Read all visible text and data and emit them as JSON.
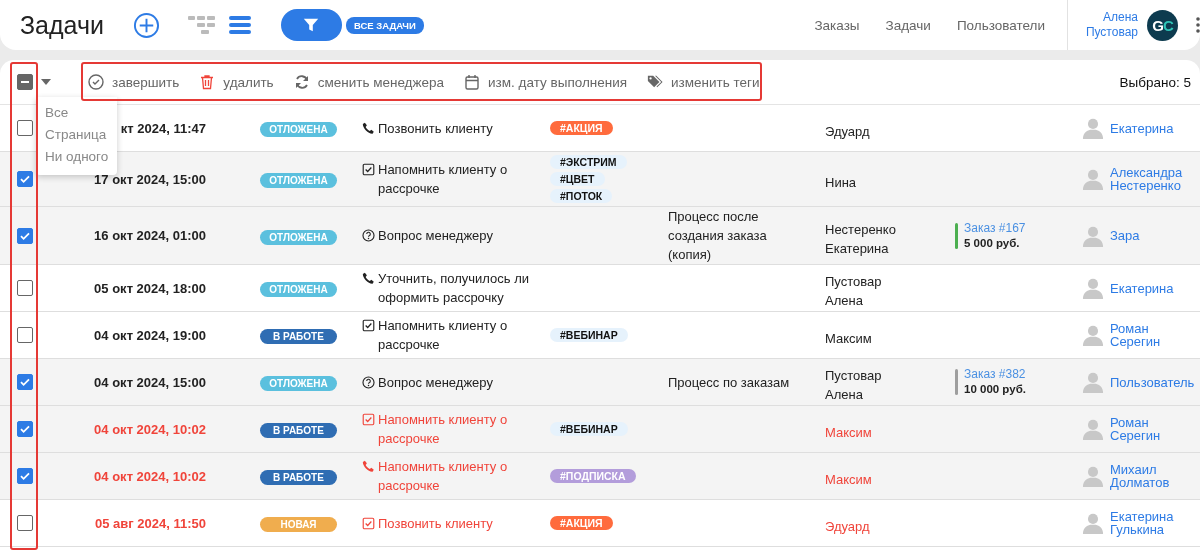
{
  "header": {
    "title": "Задачи",
    "filter_label": "ВСЕ ЗАДАЧИ",
    "nav": [
      {
        "label": "Заказы"
      },
      {
        "label": "Задачи"
      },
      {
        "label": "Пользователи"
      }
    ],
    "user": {
      "name": [
        "Алена",
        "Пустовар"
      ],
      "initials": [
        "G",
        "C"
      ]
    }
  },
  "toolbar": {
    "select_all": {
      "partial": true
    },
    "actions": [
      {
        "kind": "complete",
        "label": "завершить"
      },
      {
        "kind": "delete",
        "label": "удалить"
      },
      {
        "kind": "reassign",
        "label": "сменить менеджера"
      },
      {
        "kind": "date",
        "label": "изм. дату выполнения"
      },
      {
        "kind": "tags",
        "label": "изменить теги"
      }
    ],
    "selected_count": "Выбрано: 5"
  },
  "select_menu": {
    "items": [
      "Все",
      "Страница",
      "Ни одного"
    ]
  },
  "rows": [
    {
      "checked": false,
      "overdue": false,
      "date": "кт 2024, 11:47",
      "status": {
        "kind": "postponed",
        "label": "ОТЛОЖЕНА"
      },
      "task": {
        "kind": "call",
        "text": "Позвонить клиенту"
      },
      "tags": [
        {
          "label": "#АКЦИЯ",
          "color": "#ff6b3d"
        }
      ],
      "client": [
        "Эдуард"
      ],
      "manager": [
        "Екатерина"
      ]
    },
    {
      "checked": true,
      "overdue": false,
      "date": "17 окт 2024, 15:00",
      "status": {
        "kind": "postponed",
        "label": "ОТЛОЖЕНА"
      },
      "task": {
        "kind": "reminder",
        "text": "Напомнить клиенту о рассрочке"
      },
      "tags": [
        {
          "label": "#ЭКСТРИМ",
          "color": "#e6f2fc"
        },
        {
          "label": "#ЦВЕТ",
          "color": "#e6f2fc"
        },
        {
          "label": "#ПОТОК",
          "color": "#e6f2fc"
        }
      ],
      "client": [
        "Нина"
      ],
      "manager": [
        "Александра",
        "Нестеренко"
      ]
    },
    {
      "checked": true,
      "overdue": false,
      "date": "16 окт 2024, 01:00",
      "status": {
        "kind": "postponed",
        "label": "ОТЛОЖЕНА"
      },
      "task": {
        "kind": "question",
        "text": "Вопрос менеджеру"
      },
      "process": "Процесс после создания заказа (копия)",
      "client": [
        "Нестеренко",
        "Екатерина"
      ],
      "order": {
        "title": "Заказ #167",
        "amount": "5 000 руб.",
        "color": "#4caf50"
      },
      "manager": [
        "Зара"
      ]
    },
    {
      "checked": false,
      "overdue": false,
      "date": "05 окт 2024, 18:00",
      "status": {
        "kind": "postponed",
        "label": "ОТЛОЖЕНА"
      },
      "task": {
        "kind": "call",
        "text": "Уточнить, получилось ли оформить рассрочку"
      },
      "client": [
        "Пустовар",
        "Алена"
      ],
      "manager": [
        "Екатерина"
      ]
    },
    {
      "checked": false,
      "overdue": false,
      "date": "04 окт 2024, 19:00",
      "status": {
        "kind": "in_progress",
        "label": "В РАБОТЕ"
      },
      "task": {
        "kind": "reminder",
        "text": "Напомнить клиенту о рассрочке"
      },
      "tags": [
        {
          "label": "#ВЕБИНАР",
          "color": "#e6f2fc"
        }
      ],
      "client": [
        "Максим"
      ],
      "manager": [
        "Роман",
        "Серегин"
      ]
    },
    {
      "checked": true,
      "overdue": false,
      "date": "04 окт 2024, 15:00",
      "status": {
        "kind": "postponed",
        "label": "ОТЛОЖЕНА"
      },
      "task": {
        "kind": "question",
        "text": "Вопрос менеджеру"
      },
      "process": "Процесс по заказам",
      "client": [
        "Пустовар",
        "Алена"
      ],
      "order": {
        "title": "Заказ #382",
        "amount": "10 000 руб.",
        "color": "#9e9e9e"
      },
      "manager": [
        "Пользователь"
      ]
    },
    {
      "checked": true,
      "overdue": true,
      "date": "04 окт 2024, 10:02",
      "status": {
        "kind": "in_progress",
        "label": "В РАБОТЕ"
      },
      "task": {
        "kind": "reminder",
        "text": "Напомнить клиенту о рассрочке"
      },
      "tags": [
        {
          "label": "#ВЕБИНАР",
          "color": "#e6f2fc"
        }
      ],
      "client": [
        "Максим"
      ],
      "manager": [
        "Роман",
        "Серегин"
      ]
    },
    {
      "checked": true,
      "overdue": true,
      "date": "04 окт 2024, 10:02",
      "status": {
        "kind": "in_progress",
        "label": "В РАБОТЕ"
      },
      "task": {
        "kind": "call",
        "text": "Напомнить клиенту о рассрочке"
      },
      "tags": [
        {
          "label": "#ПОДПИСКА",
          "color": "#b39ddb"
        }
      ],
      "client": [
        "Максим"
      ],
      "manager": [
        "Михаил",
        "Долматов"
      ]
    },
    {
      "checked": false,
      "overdue": true,
      "date": "05 авг 2024, 11:50",
      "status": {
        "kind": "new",
        "label": "НОВАЯ"
      },
      "task": {
        "kind": "reminder",
        "text": "Позвонить клиенту"
      },
      "tags": [
        {
          "label": "#АКЦИЯ",
          "color": "#ff6b3d"
        }
      ],
      "client": [
        "Эдуард"
      ],
      "manager": [
        "Екатерина",
        "Гулькина"
      ]
    }
  ]
}
